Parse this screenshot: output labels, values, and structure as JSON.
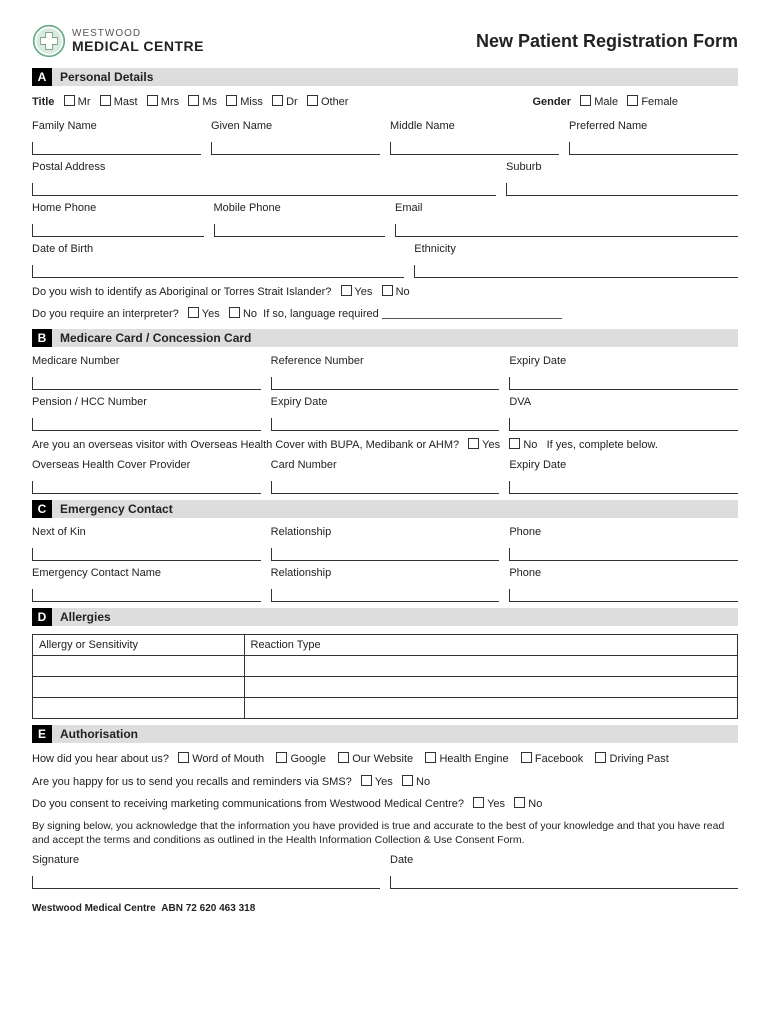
{
  "logo": {
    "line1": "WESTWOOD",
    "line2": "MEDICAL CENTRE"
  },
  "form_title": "New Patient Registration Form",
  "section_a": {
    "letter": "A",
    "title": "Personal Details",
    "title_label": "Title",
    "title_options": [
      "Mr",
      "Mast",
      "Mrs",
      "Ms",
      "Miss",
      "Dr",
      "Other"
    ],
    "gender_label": "Gender",
    "gender_options": [
      "Male",
      "Female"
    ],
    "family_name": "Family Name",
    "given_name": "Given Name",
    "middle_name": "Middle Name",
    "preferred_name": "Preferred Name",
    "postal_address": "Postal Address",
    "suburb": "Suburb",
    "home_phone": "Home Phone",
    "mobile_phone": "Mobile Phone",
    "email": "Email",
    "dob": "Date of Birth",
    "ethnicity": "Ethnicity",
    "atsi_q": "Do you wish to identify as Aboriginal or Torres Strait Islander?",
    "interpreter_q": "Do you require an interpreter?",
    "interpreter_suffix": "If so, language required",
    "yes": "Yes",
    "no": "No"
  },
  "section_b": {
    "letter": "B",
    "title": "Medicare Card / Concession Card",
    "medicare_number": "Medicare Number",
    "reference_number": "Reference Number",
    "expiry_date": "Expiry Date",
    "pension": "Pension / HCC Number",
    "dva": "DVA",
    "overseas_q": "Are you an overseas visitor with Overseas Health Cover with BUPA, Medibank or AHM?",
    "overseas_suffix": "If yes, complete below.",
    "ohc_provider": "Overseas Health Cover Provider",
    "card_number": "Card Number",
    "yes": "Yes",
    "no": "No"
  },
  "section_c": {
    "letter": "C",
    "title": "Emergency Contact",
    "next_of_kin": "Next of Kin",
    "relationship": "Relationship",
    "phone": "Phone",
    "emergency_name": "Emergency Contact Name"
  },
  "section_d": {
    "letter": "D",
    "title": "Allergies",
    "col1": "Allergy or Sensitivity",
    "col2": "Reaction Type"
  },
  "section_e": {
    "letter": "E",
    "title": "Authorisation",
    "hear_q": "How did you hear about us?",
    "hear_options": [
      "Word of Mouth",
      "Google",
      "Our Website",
      "Health Engine",
      "Facebook",
      "Driving Past"
    ],
    "sms_q": "Are you happy for us to send you recalls and reminders via SMS?",
    "marketing_q": "Do you consent to receiving marketing communications from Westwood Medical Centre?",
    "consent": "By signing below, you acknowledge that the information you have provided is true and accurate to the best of your knowledge and that you have read and accept the terms and conditions as outlined in the Health Information Collection & Use Consent Form.",
    "signature": "Signature",
    "date": "Date",
    "yes": "Yes",
    "no": "No"
  },
  "footer": {
    "name": "Westwood Medical Centre",
    "abn": "ABN 72 620 463 318"
  }
}
